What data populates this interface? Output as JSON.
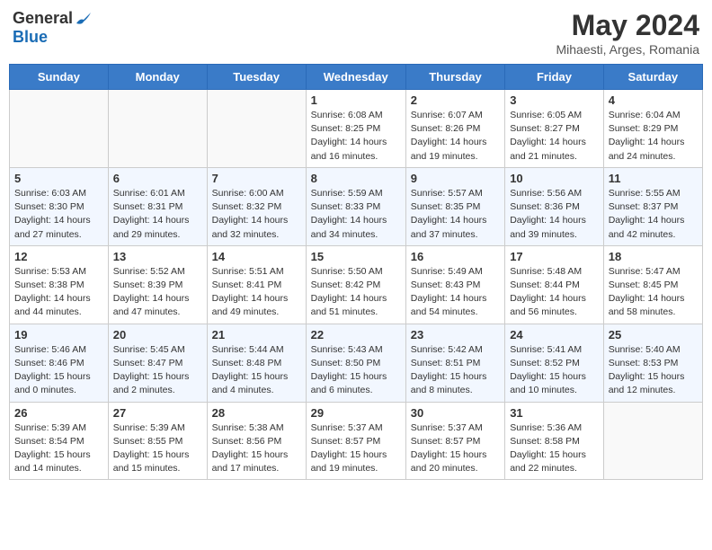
{
  "header": {
    "logo_general": "General",
    "logo_blue": "Blue",
    "month_title": "May 2024",
    "subtitle": "Mihaesti, Arges, Romania"
  },
  "weekdays": [
    "Sunday",
    "Monday",
    "Tuesday",
    "Wednesday",
    "Thursday",
    "Friday",
    "Saturday"
  ],
  "weeks": [
    [
      {
        "day": "",
        "info": ""
      },
      {
        "day": "",
        "info": ""
      },
      {
        "day": "",
        "info": ""
      },
      {
        "day": "1",
        "info": "Sunrise: 6:08 AM\nSunset: 8:25 PM\nDaylight: 14 hours\nand 16 minutes."
      },
      {
        "day": "2",
        "info": "Sunrise: 6:07 AM\nSunset: 8:26 PM\nDaylight: 14 hours\nand 19 minutes."
      },
      {
        "day": "3",
        "info": "Sunrise: 6:05 AM\nSunset: 8:27 PM\nDaylight: 14 hours\nand 21 minutes."
      },
      {
        "day": "4",
        "info": "Sunrise: 6:04 AM\nSunset: 8:29 PM\nDaylight: 14 hours\nand 24 minutes."
      }
    ],
    [
      {
        "day": "5",
        "info": "Sunrise: 6:03 AM\nSunset: 8:30 PM\nDaylight: 14 hours\nand 27 minutes."
      },
      {
        "day": "6",
        "info": "Sunrise: 6:01 AM\nSunset: 8:31 PM\nDaylight: 14 hours\nand 29 minutes."
      },
      {
        "day": "7",
        "info": "Sunrise: 6:00 AM\nSunset: 8:32 PM\nDaylight: 14 hours\nand 32 minutes."
      },
      {
        "day": "8",
        "info": "Sunrise: 5:59 AM\nSunset: 8:33 PM\nDaylight: 14 hours\nand 34 minutes."
      },
      {
        "day": "9",
        "info": "Sunrise: 5:57 AM\nSunset: 8:35 PM\nDaylight: 14 hours\nand 37 minutes."
      },
      {
        "day": "10",
        "info": "Sunrise: 5:56 AM\nSunset: 8:36 PM\nDaylight: 14 hours\nand 39 minutes."
      },
      {
        "day": "11",
        "info": "Sunrise: 5:55 AM\nSunset: 8:37 PM\nDaylight: 14 hours\nand 42 minutes."
      }
    ],
    [
      {
        "day": "12",
        "info": "Sunrise: 5:53 AM\nSunset: 8:38 PM\nDaylight: 14 hours\nand 44 minutes."
      },
      {
        "day": "13",
        "info": "Sunrise: 5:52 AM\nSunset: 8:39 PM\nDaylight: 14 hours\nand 47 minutes."
      },
      {
        "day": "14",
        "info": "Sunrise: 5:51 AM\nSunset: 8:41 PM\nDaylight: 14 hours\nand 49 minutes."
      },
      {
        "day": "15",
        "info": "Sunrise: 5:50 AM\nSunset: 8:42 PM\nDaylight: 14 hours\nand 51 minutes."
      },
      {
        "day": "16",
        "info": "Sunrise: 5:49 AM\nSunset: 8:43 PM\nDaylight: 14 hours\nand 54 minutes."
      },
      {
        "day": "17",
        "info": "Sunrise: 5:48 AM\nSunset: 8:44 PM\nDaylight: 14 hours\nand 56 minutes."
      },
      {
        "day": "18",
        "info": "Sunrise: 5:47 AM\nSunset: 8:45 PM\nDaylight: 14 hours\nand 58 minutes."
      }
    ],
    [
      {
        "day": "19",
        "info": "Sunrise: 5:46 AM\nSunset: 8:46 PM\nDaylight: 15 hours\nand 0 minutes."
      },
      {
        "day": "20",
        "info": "Sunrise: 5:45 AM\nSunset: 8:47 PM\nDaylight: 15 hours\nand 2 minutes."
      },
      {
        "day": "21",
        "info": "Sunrise: 5:44 AM\nSunset: 8:48 PM\nDaylight: 15 hours\nand 4 minutes."
      },
      {
        "day": "22",
        "info": "Sunrise: 5:43 AM\nSunset: 8:50 PM\nDaylight: 15 hours\nand 6 minutes."
      },
      {
        "day": "23",
        "info": "Sunrise: 5:42 AM\nSunset: 8:51 PM\nDaylight: 15 hours\nand 8 minutes."
      },
      {
        "day": "24",
        "info": "Sunrise: 5:41 AM\nSunset: 8:52 PM\nDaylight: 15 hours\nand 10 minutes."
      },
      {
        "day": "25",
        "info": "Sunrise: 5:40 AM\nSunset: 8:53 PM\nDaylight: 15 hours\nand 12 minutes."
      }
    ],
    [
      {
        "day": "26",
        "info": "Sunrise: 5:39 AM\nSunset: 8:54 PM\nDaylight: 15 hours\nand 14 minutes."
      },
      {
        "day": "27",
        "info": "Sunrise: 5:39 AM\nSunset: 8:55 PM\nDaylight: 15 hours\nand 15 minutes."
      },
      {
        "day": "28",
        "info": "Sunrise: 5:38 AM\nSunset: 8:56 PM\nDaylight: 15 hours\nand 17 minutes."
      },
      {
        "day": "29",
        "info": "Sunrise: 5:37 AM\nSunset: 8:57 PM\nDaylight: 15 hours\nand 19 minutes."
      },
      {
        "day": "30",
        "info": "Sunrise: 5:37 AM\nSunset: 8:57 PM\nDaylight: 15 hours\nand 20 minutes."
      },
      {
        "day": "31",
        "info": "Sunrise: 5:36 AM\nSunset: 8:58 PM\nDaylight: 15 hours\nand 22 minutes."
      },
      {
        "day": "",
        "info": ""
      }
    ]
  ]
}
